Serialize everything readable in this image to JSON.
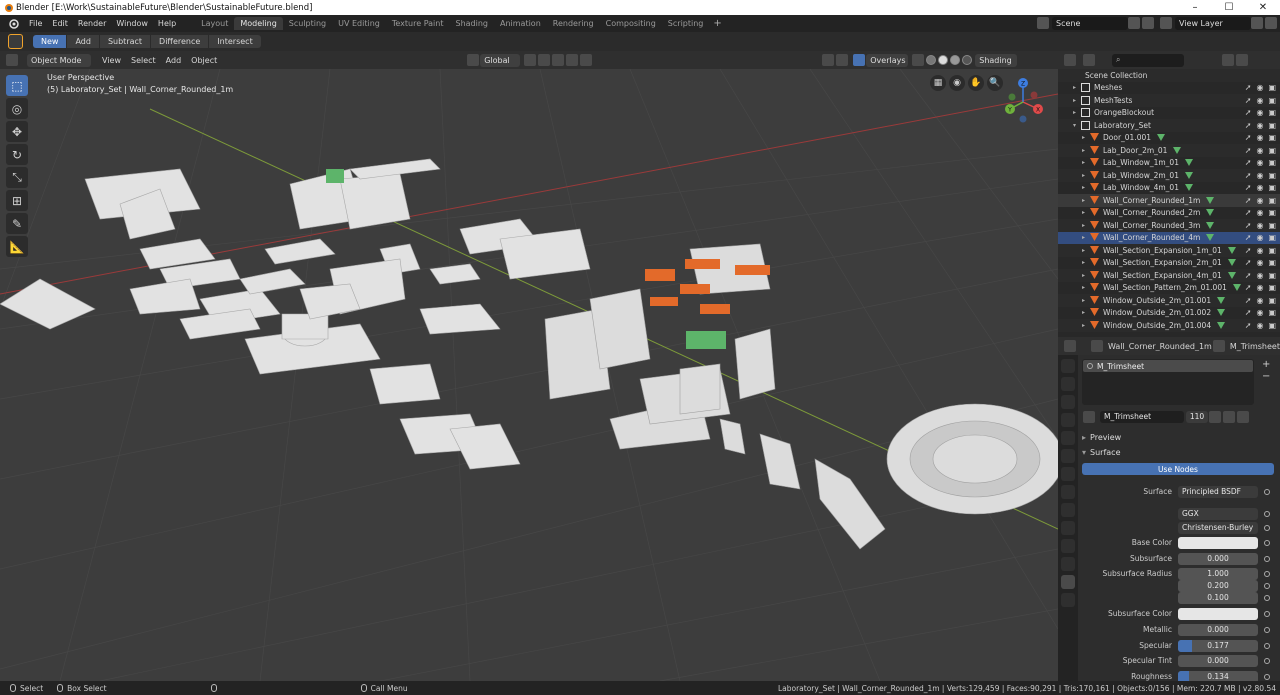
{
  "window": {
    "title": "Blender [E:\\Work\\SustainableFuture\\Blender\\SustainableFuture.blend]",
    "controls": [
      "–",
      "☐",
      "✕"
    ]
  },
  "menubar": {
    "menus": [
      "File",
      "Edit",
      "Render",
      "Window",
      "Help"
    ],
    "workspaces": [
      "Layout",
      "Modeling",
      "Sculpting",
      "UV Editing",
      "Texture Paint",
      "Shading",
      "Animation",
      "Rendering",
      "Compositing",
      "Scripting"
    ],
    "active_workspace": "Modeling",
    "add": "+",
    "scene": "Scene",
    "view_layer": "View Layer"
  },
  "toolheader": {
    "modes": [
      "New",
      "Add",
      "Subtract",
      "Difference",
      "Intersect"
    ],
    "active": "New"
  },
  "viewport_header": {
    "mode": "Object Mode",
    "menus": [
      "View",
      "Select",
      "Add",
      "Object"
    ],
    "transform_orientation": "Global",
    "overlays": "Overlays",
    "shading": "Shading"
  },
  "viewport": {
    "perspective": "User Perspective",
    "active_info": "(5) Laboratory_Set | Wall_Corner_Rounded_1m",
    "gizmo_axes": [
      "X",
      "Y",
      "Z"
    ]
  },
  "outliner": {
    "search_placeholder": "",
    "items": [
      {
        "label": "Scene Collection",
        "level": 0,
        "kind": "scene"
      },
      {
        "label": "Meshes",
        "level": 1,
        "kind": "collection"
      },
      {
        "label": "MeshTests",
        "level": 1,
        "kind": "collection"
      },
      {
        "label": "OrangeBlockout",
        "level": 1,
        "kind": "collection"
      },
      {
        "label": "Laboratory_Set",
        "level": 1,
        "kind": "collection"
      },
      {
        "label": "Door_01.001",
        "level": 2,
        "kind": "object"
      },
      {
        "label": "Lab_Door_2m_01",
        "level": 2,
        "kind": "object"
      },
      {
        "label": "Lab_Window_1m_01",
        "level": 2,
        "kind": "object"
      },
      {
        "label": "Lab_Window_2m_01",
        "level": 2,
        "kind": "object"
      },
      {
        "label": "Lab_Window_4m_01",
        "level": 2,
        "kind": "object"
      },
      {
        "label": "Wall_Corner_Rounded_1m",
        "level": 2,
        "kind": "object",
        "state": "active"
      },
      {
        "label": "Wall_Corner_Rounded_2m",
        "level": 2,
        "kind": "object"
      },
      {
        "label": "Wall_Corner_Rounded_3m",
        "level": 2,
        "kind": "object"
      },
      {
        "label": "Wall_Corner_Rounded_4m",
        "level": 2,
        "kind": "object",
        "state": "selected"
      },
      {
        "label": "Wall_Section_Expansion_1m_01",
        "level": 2,
        "kind": "object"
      },
      {
        "label": "Wall_Section_Expansion_2m_01",
        "level": 2,
        "kind": "object"
      },
      {
        "label": "Wall_Section_Expansion_4m_01",
        "level": 2,
        "kind": "object"
      },
      {
        "label": "Wall_Section_Pattern_2m_01.001",
        "level": 2,
        "kind": "object"
      },
      {
        "label": "Window_Outside_2m_01.001",
        "level": 2,
        "kind": "object"
      },
      {
        "label": "Window_Outside_2m_01.002",
        "level": 2,
        "kind": "object"
      },
      {
        "label": "Window_Outside_2m_01.004",
        "level": 2,
        "kind": "object"
      }
    ]
  },
  "properties": {
    "header_object": "Wall_Corner_Rounded_1m",
    "header_material": "M_Trimsheet",
    "slot": "M_Trimsheet",
    "material_name": "M_Trimsheet",
    "users": "110",
    "panels": {
      "preview": "Preview",
      "surface": "Surface"
    },
    "use_nodes": "Use Nodes",
    "rows": [
      {
        "label": "Surface",
        "value": "Principled BSDF",
        "style": "dark"
      },
      {
        "label": "",
        "value": "GGX",
        "style": "dark"
      },
      {
        "label": "",
        "value": "Christensen-Burley",
        "style": "dark"
      },
      {
        "label": "Base Color",
        "value": "",
        "style": "white"
      },
      {
        "label": "Subsurface",
        "value": "0.000",
        "style": "num"
      },
      {
        "label": "Subsurface Radius",
        "value": "1.000",
        "style": "num"
      },
      {
        "label": "",
        "value": "0.200",
        "style": "num"
      },
      {
        "label": "",
        "value": "0.100",
        "style": "num"
      },
      {
        "label": "Subsurface Color",
        "value": "",
        "style": "white"
      },
      {
        "label": "Metallic",
        "value": "0.000",
        "style": "num"
      },
      {
        "label": "Specular",
        "value": "0.177",
        "style": "num",
        "fill": 0.177
      },
      {
        "label": "Specular Tint",
        "value": "0.000",
        "style": "num"
      },
      {
        "label": "Roughness",
        "value": "0.134",
        "style": "num",
        "fill": 0.134
      }
    ]
  },
  "statusbar": {
    "select": "Select",
    "box_select": "Box Select",
    "call_menu": "Call Menu",
    "stats": "Laboratory_Set | Wall_Corner_Rounded_1m | Verts:129,459 | Faces:90,291 | Tris:170,161 | Objects:0/156 | Mem: 220.7 MB | v2.80.54"
  },
  "colors": {
    "accent": "#4772b3",
    "selection": "#f0a32c",
    "orange_object": "#e36a2a",
    "green_object": "#5db46a"
  }
}
